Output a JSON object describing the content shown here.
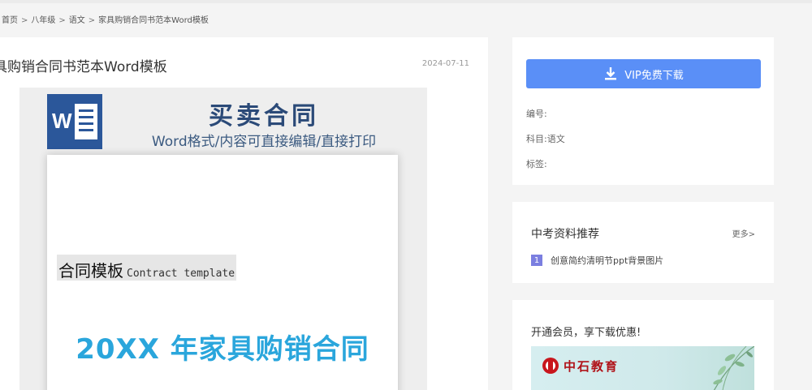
{
  "breadcrumb": {
    "items": [
      "首页",
      "八年级",
      "语文",
      "家具购销合同书范本Word模板"
    ],
    "separator": ">"
  },
  "document": {
    "title": "具购销合同书范本Word模板",
    "date": "2024-07-11"
  },
  "preview": {
    "hero_title": "买卖合同",
    "hero_subtitle": "Word格式/内容可直接编辑/直接打印",
    "logo_letter": "W",
    "template_label_zh": "合同模板",
    "template_label_en": "Contract template",
    "contract_name": "20XX 年家具购销合同"
  },
  "download": {
    "button_label": "VIP免费下载",
    "icon": "download-icon"
  },
  "meta": {
    "code_label": "编号:",
    "subject_label": "科目:",
    "subject_value": "语文",
    "tags_label": "标签:"
  },
  "recommend": {
    "title": "中考资料推荐",
    "more_label": "更多>",
    "items": [
      {
        "num": "1",
        "label": "创意简约清明节ppt背景图片"
      }
    ]
  },
  "promo": {
    "title": "开通会员，享下载优惠!",
    "brand": "中石教育"
  },
  "colors": {
    "vip_button": "#5a8ff7",
    "word_blue": "#2b579a",
    "contract_name": "#2aa6dc",
    "rec_badge": "#7b7fe0",
    "brand_red": "#c8161d"
  }
}
